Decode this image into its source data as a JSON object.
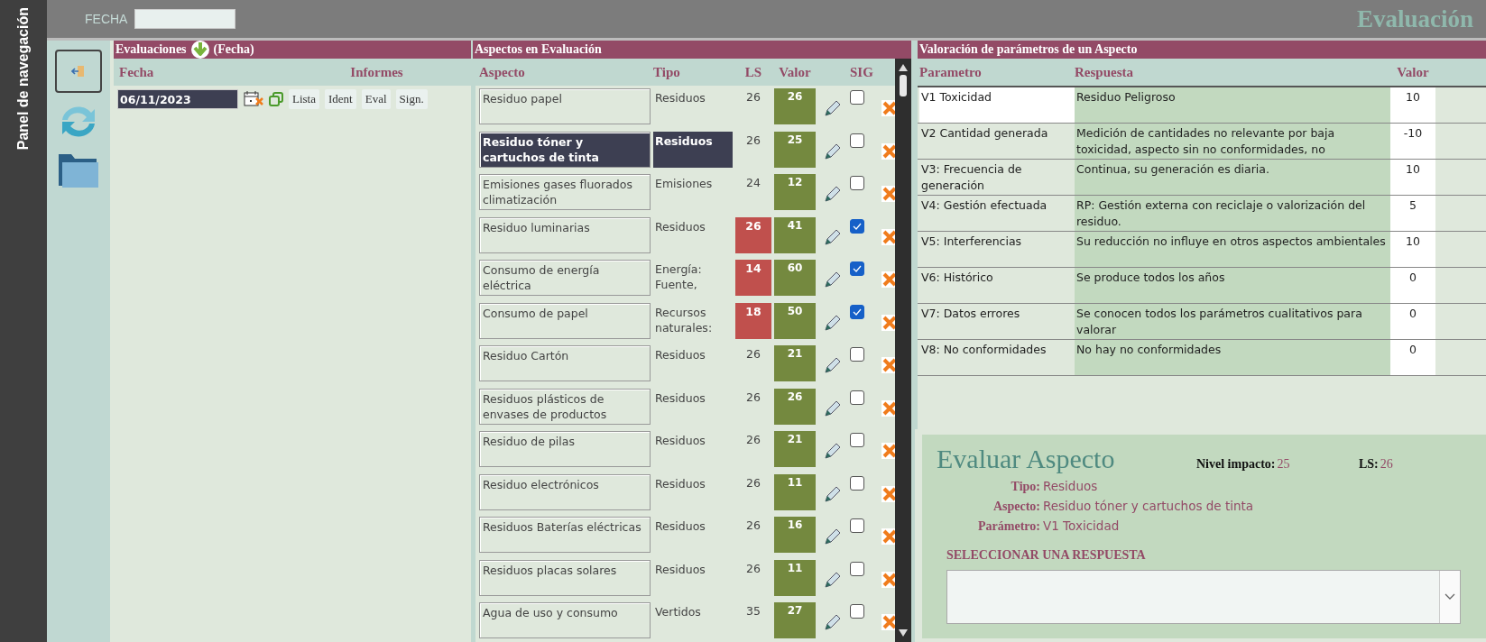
{
  "side_panel": {
    "title": "Panel de navegación"
  },
  "header": {
    "fecha_label": "FECHA",
    "title": "Evaluación"
  },
  "evaluaciones": {
    "title": "Evaluaciones",
    "title_suffix": "(Fecha)",
    "columns": [
      "Fecha",
      "Informes"
    ],
    "rows": [
      {
        "fecha": "06/11/2023",
        "selected": true,
        "buttons": [
          "Lista",
          "Ident",
          "Eval",
          "Sign."
        ]
      }
    ]
  },
  "aspectos": {
    "title": "Aspectos en Evaluación",
    "columns": [
      "Aspecto",
      "Tipo",
      "LS",
      "Valor",
      "SIG"
    ],
    "rows": [
      {
        "aspecto": "Residuo papel",
        "tipo": "Residuos",
        "ls": "26",
        "ls_alert": false,
        "valor": "26",
        "sig": false,
        "selected": false
      },
      {
        "aspecto": "Residuo tóner y cartuchos de tinta",
        "tipo": "Residuos",
        "ls": "26",
        "ls_alert": false,
        "valor": "25",
        "sig": false,
        "selected": true
      },
      {
        "aspecto": "Emisiones gases fluorados climatización",
        "tipo": "Emisiones",
        "ls": "24",
        "ls_alert": false,
        "valor": "12",
        "sig": false,
        "selected": false
      },
      {
        "aspecto": "Residuo luminarias",
        "tipo": "Residuos",
        "ls": "26",
        "ls_alert": true,
        "valor": "41",
        "sig": true,
        "selected": false
      },
      {
        "aspecto": "Consumo de energía eléctrica",
        "tipo": "Energía: Fuente,",
        "ls": "14",
        "ls_alert": true,
        "valor": "60",
        "sig": true,
        "selected": false
      },
      {
        "aspecto": "Consumo de papel",
        "tipo": "Recursos naturales:",
        "ls": "18",
        "ls_alert": true,
        "valor": "50",
        "sig": true,
        "selected": false
      },
      {
        "aspecto": "Residuo Cartón",
        "tipo": "Residuos",
        "ls": "26",
        "ls_alert": false,
        "valor": "21",
        "sig": false,
        "selected": false
      },
      {
        "aspecto": "Residuos plásticos de envases de productos",
        "tipo": "Residuos",
        "ls": "26",
        "ls_alert": false,
        "valor": "26",
        "sig": false,
        "selected": false
      },
      {
        "aspecto": "Residuo de pilas",
        "tipo": "Residuos",
        "ls": "26",
        "ls_alert": false,
        "valor": "21",
        "sig": false,
        "selected": false
      },
      {
        "aspecto": "Residuo electrónicos",
        "tipo": "Residuos",
        "ls": "26",
        "ls_alert": false,
        "valor": "11",
        "sig": false,
        "selected": false
      },
      {
        "aspecto": "Residuos Baterías eléctricas",
        "tipo": "Residuos",
        "ls": "26",
        "ls_alert": false,
        "valor": "16",
        "sig": false,
        "selected": false
      },
      {
        "aspecto": "Residuos placas solares",
        "tipo": "Residuos",
        "ls": "26",
        "ls_alert": false,
        "valor": "11",
        "sig": false,
        "selected": false
      },
      {
        "aspecto": "Agua de uso y consumo",
        "tipo": "Vertidos",
        "ls": "35",
        "ls_alert": false,
        "valor": "27",
        "sig": false,
        "selected": false
      }
    ]
  },
  "valoracion": {
    "title": "Valoración de parámetros de un Aspecto",
    "columns": [
      "Parametro",
      "Respuesta",
      "Valor"
    ],
    "rows": [
      {
        "parametro": "V1 Toxicidad",
        "respuesta": "Residuo Peligroso",
        "valor": "10",
        "selected": true
      },
      {
        "parametro": "V2 Cantidad generada",
        "respuesta": "Medición de cantidades no relevante por baja toxicidad, aspecto sin no conformidades, no",
        "valor": "-10",
        "selected": false
      },
      {
        "parametro": "V3: Frecuencia de generación",
        "respuesta": "Continua, su generación es diaria.",
        "valor": "10",
        "selected": false
      },
      {
        "parametro": "V4: Gestión efectuada",
        "respuesta": "RP: Gestión externa con reciclaje o valorización del residuo.",
        "valor": "5",
        "selected": false
      },
      {
        "parametro": "V5: Interferencias",
        "respuesta": "Su reducción no influye en otros aspectos ambientales",
        "valor": "10",
        "selected": false
      },
      {
        "parametro": "V6: Histórico",
        "respuesta": "Se produce todos los años",
        "valor": "0",
        "selected": false
      },
      {
        "parametro": "V7: Datos errores",
        "respuesta": "Se conocen todos los parámetros cualitativos para valorar",
        "valor": "0",
        "selected": false
      },
      {
        "parametro": "V8: No conformidades",
        "respuesta": "No hay no conformidades",
        "valor": "0",
        "selected": false
      }
    ]
  },
  "evaluar": {
    "title": "Evaluar Aspecto",
    "nivel_label": "Nivel impacto:",
    "nivel": "25",
    "ls_label": "LS:",
    "ls": "26",
    "fields": [
      {
        "label": "Tipo:",
        "value": "Residuos"
      },
      {
        "label": "Aspecto:",
        "value": "Residuo tóner y cartuchos de tinta"
      },
      {
        "label": "Parámetro:",
        "value": "V1 Toxicidad"
      }
    ],
    "select_label": "SELECCIONAR UNA RESPUESTA"
  }
}
